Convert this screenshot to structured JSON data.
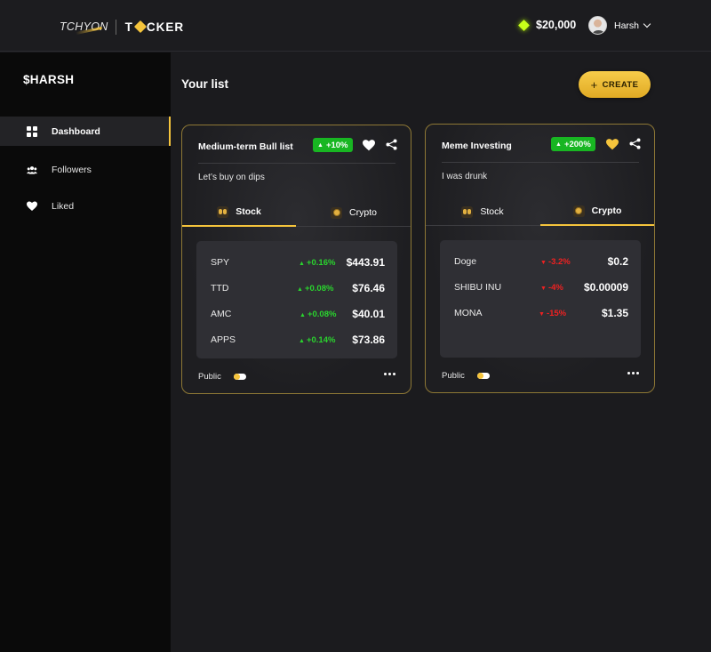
{
  "header": {
    "logo_left": "TCHYON",
    "logo_right_a": "T",
    "logo_right_b": "CKER",
    "balance": "$20,000",
    "username": "Harsh"
  },
  "sidebar": {
    "brand": "$HARSH",
    "items": [
      {
        "label": "Dashboard",
        "icon": "dashboard-icon",
        "active": true
      },
      {
        "label": "Followers",
        "icon": "followers-icon",
        "active": false
      },
      {
        "label": "Liked",
        "icon": "heart-icon",
        "active": false
      }
    ]
  },
  "main": {
    "title": "Your list",
    "create_label": "CREATE"
  },
  "cards": [
    {
      "title": "Medium-term Bull list",
      "badge": "+10%",
      "liked": false,
      "description": "Let’s buy on dips",
      "tabs": [
        {
          "label": "Stock",
          "active": true
        },
        {
          "label": "Crypto",
          "active": false
        }
      ],
      "rows": [
        {
          "symbol": "SPY",
          "change": "+0.16%",
          "direction": "up",
          "price": "$443.91"
        },
        {
          "symbol": "TTD",
          "change": "+0.08%",
          "direction": "up",
          "price": "$76.46"
        },
        {
          "symbol": "AMC",
          "change": "+0.08%",
          "direction": "up",
          "price": "$40.01"
        },
        {
          "symbol": "APPS",
          "change": "+0.14%",
          "direction": "up",
          "price": "$73.86"
        }
      ],
      "visibility": "Public"
    },
    {
      "title": "Meme Investing",
      "badge": "+200%",
      "liked": true,
      "description": "I was drunk",
      "tabs": [
        {
          "label": "Stock",
          "active": false
        },
        {
          "label": "Crypto",
          "active": true
        }
      ],
      "rows": [
        {
          "symbol": "Doge",
          "change": "-3.2%",
          "direction": "down",
          "price": "$0.2"
        },
        {
          "symbol": "SHIBU INU",
          "change": "-4%",
          "direction": "down",
          "price": "$0.00009"
        },
        {
          "symbol": "MONA",
          "change": "-15%",
          "direction": "down",
          "price": "$1.35"
        }
      ],
      "visibility": "Public"
    }
  ],
  "colors": {
    "accent": "#f5c43c",
    "positive": "#2ad52e",
    "negative": "#ef2121",
    "badge": "#18b622"
  }
}
